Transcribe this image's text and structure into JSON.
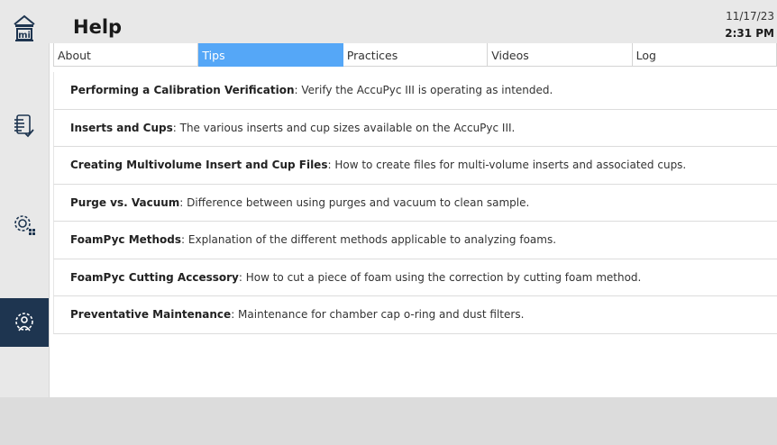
{
  "header": {
    "title": "Help",
    "date": "11/17/23",
    "time": "2:31 PM"
  },
  "sidebar": {
    "items": [
      {
        "icon": "home-icon"
      },
      {
        "icon": "report-checklist-icon"
      },
      {
        "icon": "gear-grid-icon"
      },
      {
        "icon": "gear-user-icon",
        "active": true
      }
    ]
  },
  "tabs": [
    {
      "label": "About"
    },
    {
      "label": "Tips",
      "active": true
    },
    {
      "label": "Practices"
    },
    {
      "label": "Videos"
    },
    {
      "label": "Log"
    }
  ],
  "tips": [
    {
      "title": "Performing a Calibration Verification",
      "description": ": Verify the AccuPyc III is operating as intended."
    },
    {
      "title": "Inserts and Cups",
      "description": ": The various inserts and cup sizes available on the AccuPyc III."
    },
    {
      "title": "Creating Multivolume Insert and Cup Files",
      "description": ": How to create files for multi-volume inserts and associated cups."
    },
    {
      "title": "Purge vs. Vacuum",
      "description": ": Difference between using purges and vacuum to clean sample."
    },
    {
      "title": "FoamPyc Methods",
      "description": ": Explanation of the different methods applicable to analyzing foams."
    },
    {
      "title": "FoamPyc Cutting Accessory",
      "description": ": How to cut a piece of foam using the correction by cutting foam method."
    },
    {
      "title": "Preventative Maintenance",
      "description": ": Maintenance for chamber cap o-ring and dust filters."
    }
  ],
  "colors": {
    "accent": "#55a7f7",
    "sidebar_active": "#1e3550",
    "chrome": "#e8e8e8"
  }
}
